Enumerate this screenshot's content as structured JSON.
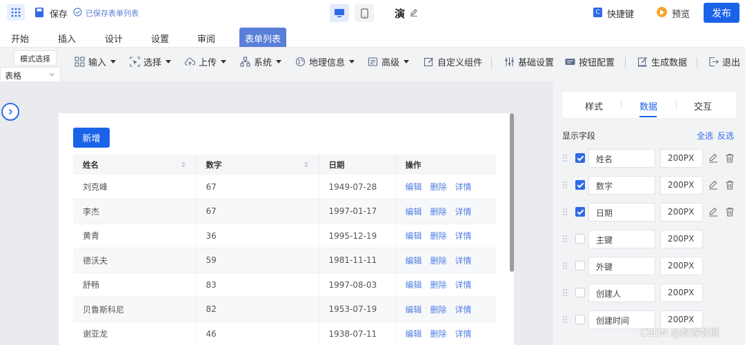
{
  "topbar": {
    "save_label": "保存",
    "saved_status": "已保存表单列表",
    "project_name": "演",
    "shortcut_label": "快捷键",
    "preview_label": "预览",
    "publish_label": "发布"
  },
  "menu": {
    "tabs": [
      {
        "label": "开始"
      },
      {
        "label": "插入"
      },
      {
        "label": "设计"
      },
      {
        "label": "设置"
      },
      {
        "label": "审阅"
      },
      {
        "label": "表单列表",
        "active": true
      }
    ]
  },
  "toolbar": {
    "mode_select_label": "模式选择",
    "mode_value": "表格",
    "items": [
      {
        "label": "输入",
        "icon": "input-icon",
        "dropdown": true
      },
      {
        "label": "选择",
        "icon": "select-icon",
        "dropdown": true
      },
      {
        "label": "上传",
        "icon": "upload-icon",
        "dropdown": true
      },
      {
        "label": "系统",
        "icon": "system-icon",
        "dropdown": true
      },
      {
        "label": "地理信息",
        "icon": "geo-icon",
        "dropdown": true
      },
      {
        "label": "高级",
        "icon": "advanced-icon",
        "dropdown": true
      },
      {
        "label": "自定义组件",
        "icon": "custom-component-icon",
        "dropdown": false
      },
      {
        "label": "基础设置",
        "icon": "settings-icon",
        "dropdown": false
      },
      {
        "label": "按钮配置",
        "icon": "button-config-icon",
        "dropdown": false
      },
      {
        "label": "生成数据",
        "icon": "generate-data-icon",
        "dropdown": false
      },
      {
        "label": "退出",
        "icon": "exit-icon",
        "dropdown": false
      }
    ]
  },
  "canvas": {
    "add_label": "新增",
    "columns": [
      "姓名",
      "数字",
      "日期",
      "操作"
    ],
    "ops": {
      "edit": "编辑",
      "delete": "删除",
      "detail": "详情"
    },
    "rows": [
      {
        "name": "刘克峰",
        "number": "67",
        "date": "1949-07-28"
      },
      {
        "name": "李杰",
        "number": "67",
        "date": "1997-01-17"
      },
      {
        "name": "黄青",
        "number": "36",
        "date": "1995-12-19"
      },
      {
        "name": "德沃夫",
        "number": "59",
        "date": "1981-11-11"
      },
      {
        "name": "舒畅",
        "number": "83",
        "date": "1997-08-03"
      },
      {
        "name": "贝鲁斯科尼",
        "number": "82",
        "date": "1953-07-19"
      },
      {
        "name": "谢亚龙",
        "number": "46",
        "date": "1938-07-11"
      }
    ]
  },
  "right_panel": {
    "tabs": [
      "样式",
      "数据",
      "交互"
    ],
    "active_tab": "数据",
    "fields_title": "显示字段",
    "select_all": "全选",
    "invert": "反选",
    "fields": [
      {
        "name": "姓名",
        "width": "200PX",
        "checked": true
      },
      {
        "name": "数字",
        "width": "200PX",
        "checked": true
      },
      {
        "name": "日期",
        "width": "200PX",
        "checked": true
      },
      {
        "name": "主键",
        "width": "200PX",
        "checked": false
      },
      {
        "name": "外键",
        "width": "200PX",
        "checked": false
      },
      {
        "name": "创建人",
        "width": "200PX",
        "checked": false
      },
      {
        "name": "创建时间",
        "width": "200PX",
        "checked": false
      }
    ]
  },
  "watermark": "CSDN @数睿数据",
  "colors": {
    "accent": "#1a63e8",
    "active_menu": "#5a7fd9",
    "link": "#4f7fe0",
    "panel_bg": "#f2f3f5",
    "canvas_bg": "#e9ebee"
  }
}
